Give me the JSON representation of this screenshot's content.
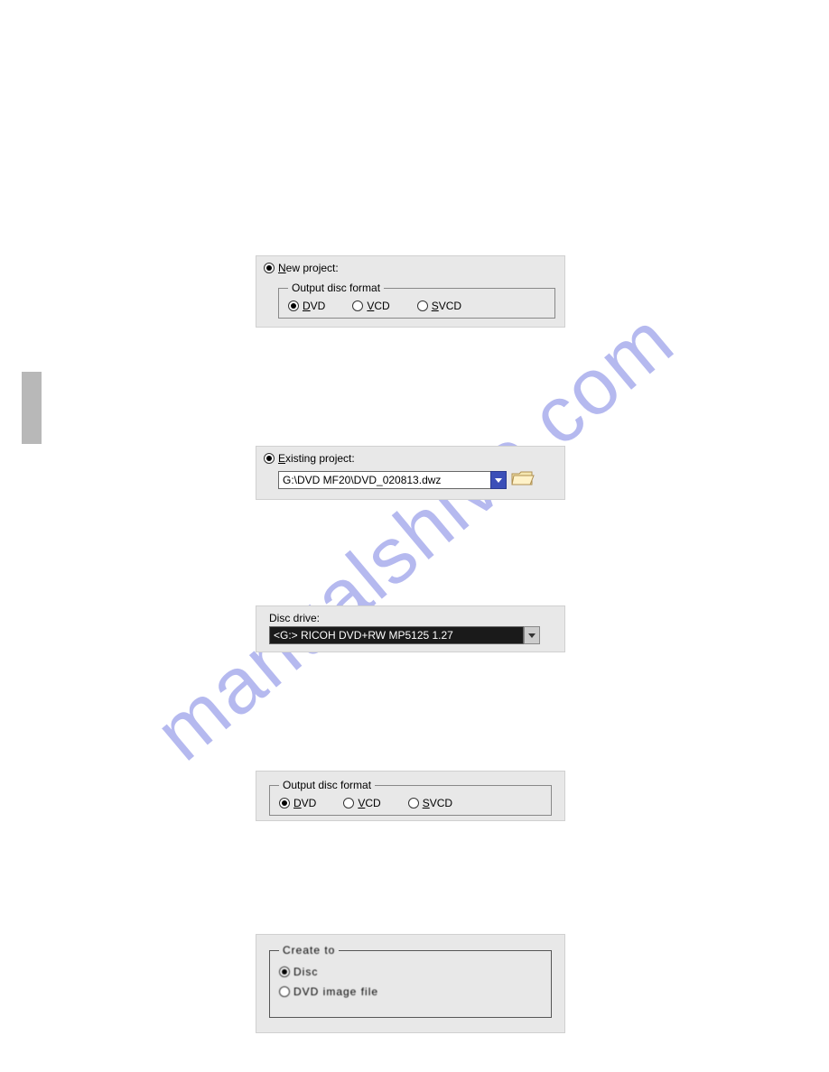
{
  "watermark": "manualshive.com",
  "panel1": {
    "radio_label": "New project:",
    "fieldset_legend": "Output disc format",
    "opt_dvd": "DVD",
    "opt_vcd": "VCD",
    "opt_svcd": "SVCD"
  },
  "panel2": {
    "radio_label": "Existing project:",
    "path_value": "G:\\DVD MF20\\DVD_020813.dwz"
  },
  "panel3": {
    "label": "Disc drive:",
    "value": "<G:> RICOH DVD+RW MP5125  1.27"
  },
  "panel4": {
    "fieldset_legend": "Output disc format",
    "opt_dvd": "DVD",
    "opt_vcd": "VCD",
    "opt_svcd": "SVCD"
  },
  "panel5": {
    "fieldset_legend": "Create to",
    "opt_disc": "Disc",
    "opt_image": "DVD image file"
  }
}
